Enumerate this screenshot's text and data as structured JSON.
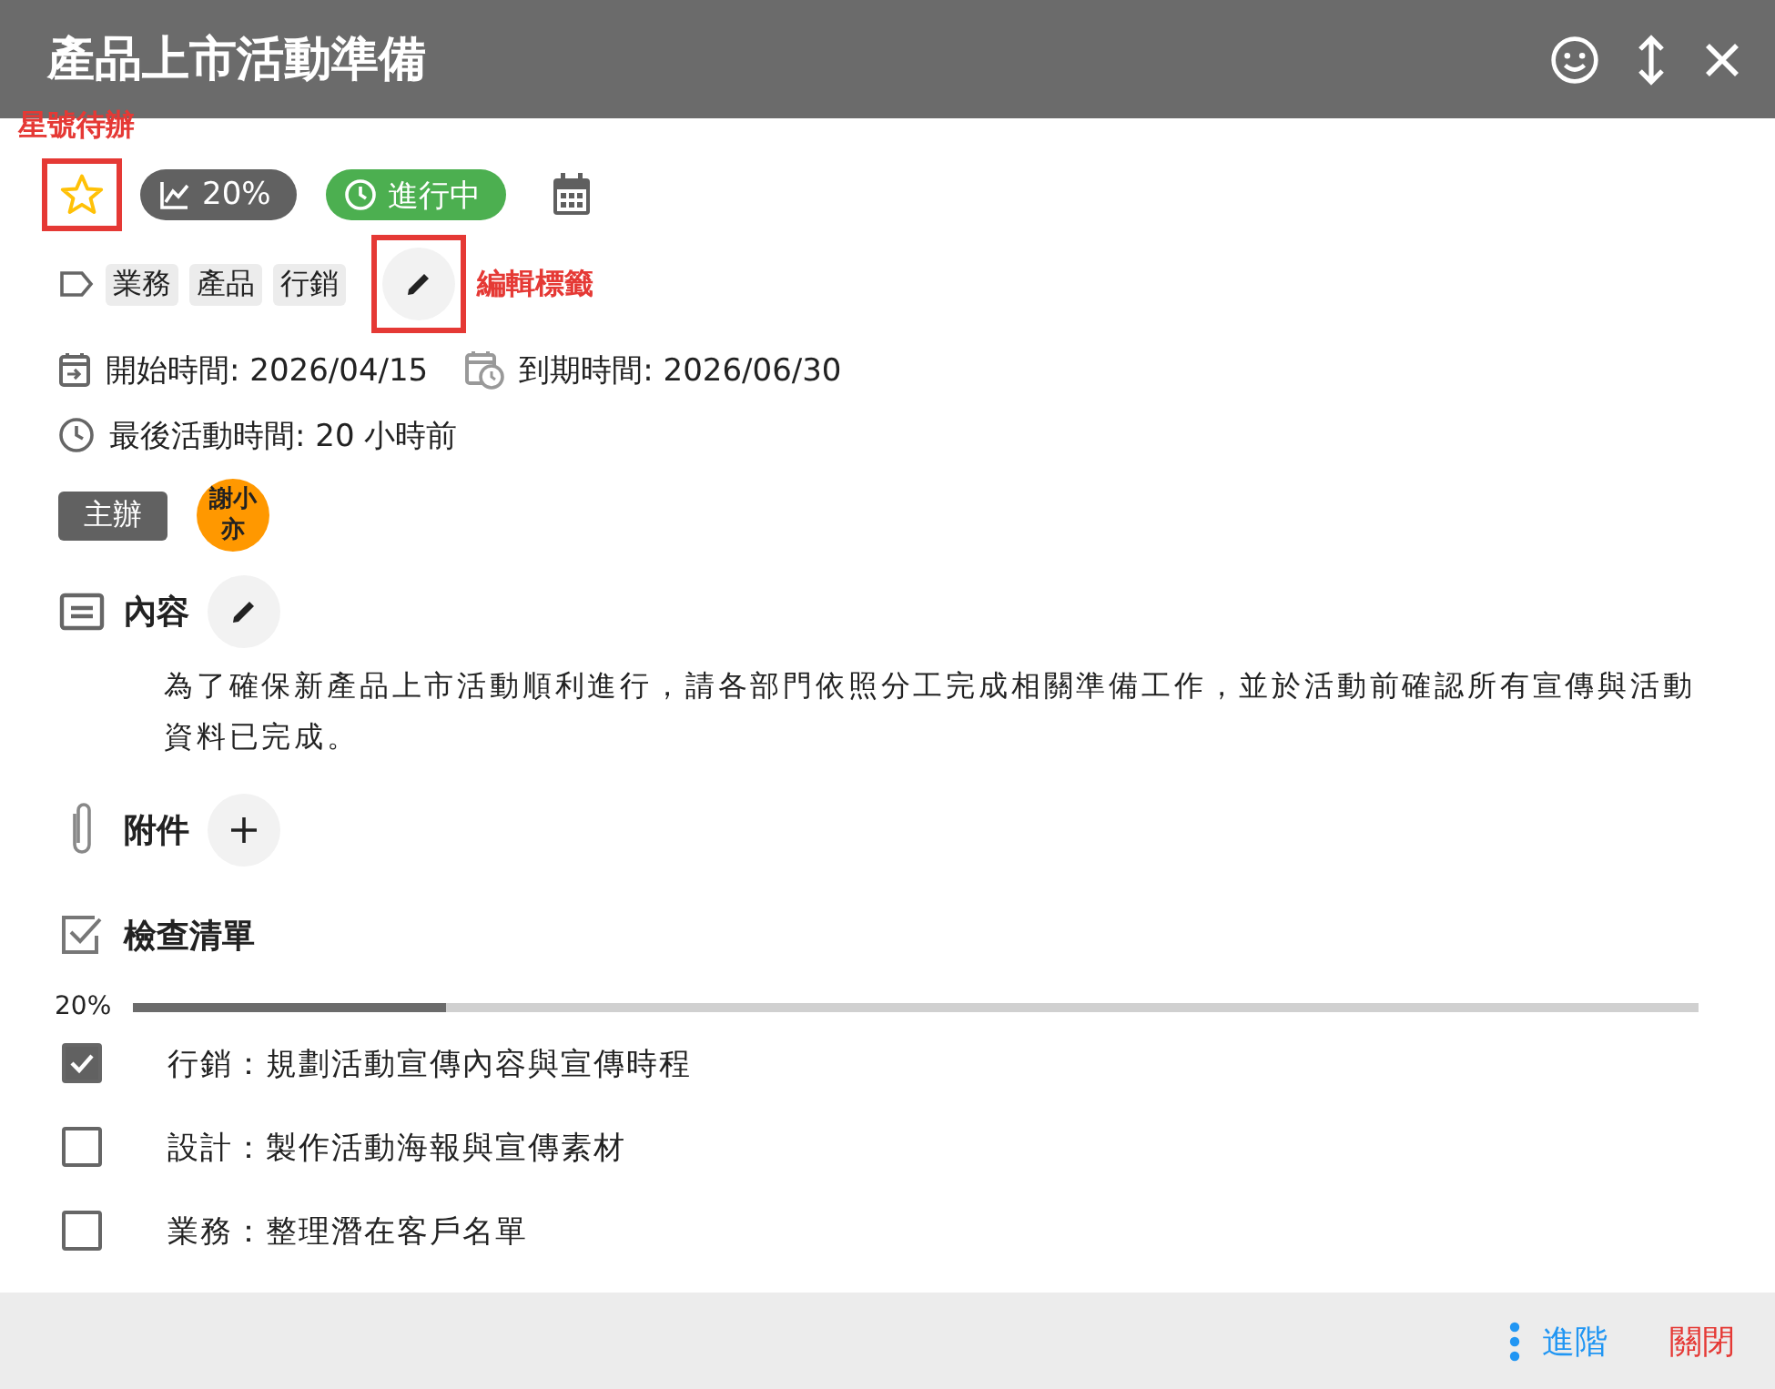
{
  "window": {
    "title": "產品上市活動準備"
  },
  "star": {
    "starred": false,
    "annotation": "星號待辦"
  },
  "progress_badge": "20%",
  "status_badge": "進行中",
  "tags": {
    "items": [
      "業務",
      "產品",
      "行銷"
    ],
    "annotation": "編輯標籤"
  },
  "start": "開始時間: 2026/04/15",
  "due": "到期時間: 2026/06/30",
  "last_activity": "最後活動時間: 20 小時前",
  "organizer": {
    "role": "主辦",
    "name": "謝小亦"
  },
  "content": {
    "heading": "內容",
    "text": "為了確保新產品上市活動順利進行，請各部門依照分工完成相關準備工作，並於活動前確認所有宣傳與活動資料已完成。"
  },
  "attachments": {
    "heading": "附件"
  },
  "checklist": {
    "heading": "檢查清單",
    "percent": "20%",
    "level": 0.2,
    "items": [
      {
        "label": "行銷：規劃活動宣傳內容與宣傳時程",
        "checked": true
      },
      {
        "label": "設計：製作活動海報與宣傳素材",
        "checked": false
      },
      {
        "label": "業務：整理潛在客戶名單",
        "checked": false
      }
    ]
  },
  "footer": {
    "advanced": "進階",
    "close": "關閉"
  }
}
